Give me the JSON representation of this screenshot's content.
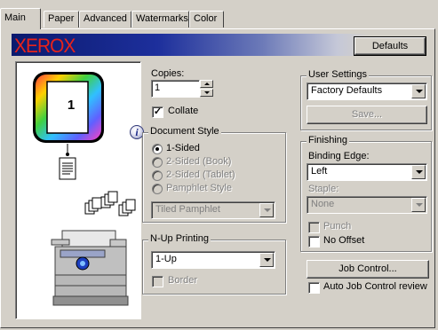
{
  "tabs": [
    {
      "label": "Main"
    },
    {
      "label": "Paper"
    },
    {
      "label": "Advanced"
    },
    {
      "label": "Watermarks"
    },
    {
      "label": "Color"
    }
  ],
  "banner": {
    "logo": "XEROX",
    "defaults_button": "Defaults"
  },
  "preview": {
    "page_number": "1"
  },
  "copies": {
    "label": "Copies:",
    "value": "1"
  },
  "collate": {
    "label": "Collate",
    "checked": true
  },
  "document_style": {
    "title": "Document Style",
    "options": [
      {
        "label": "1-Sided",
        "checked": true,
        "enabled": true
      },
      {
        "label": "2-Sided (Book)",
        "checked": false,
        "enabled": false
      },
      {
        "label": "2-Sided (Tablet)",
        "checked": false,
        "enabled": false
      },
      {
        "label": "Pamphlet Style",
        "checked": false,
        "enabled": false
      }
    ],
    "pamphlet_select": "Tiled Pamphlet"
  },
  "nup": {
    "title": "N-Up Printing",
    "select": "1-Up",
    "border_label": "Border"
  },
  "user_settings": {
    "title": "User Settings",
    "select": "Factory Defaults",
    "save_button": "Save..."
  },
  "finishing": {
    "title": "Finishing",
    "binding_edge_label": "Binding Edge:",
    "binding_edge_value": "Left",
    "staple_label": "Staple:",
    "staple_value": "None",
    "punch_label": "Punch",
    "offset_label": "No Offset"
  },
  "job_control": {
    "button": "Job Control...",
    "auto_review_label": "Auto Job Control review"
  },
  "colors": {
    "dialog_bg": "#d4d0c8",
    "banner_start": "#0b1a6e",
    "logo_red": "#e8231a"
  }
}
